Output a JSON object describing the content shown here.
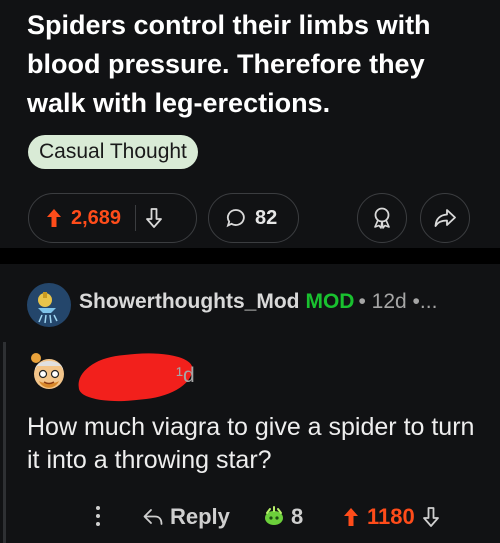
{
  "post": {
    "title": "Spiders control their limbs with blood pressure. Therefore they walk with leg-erections.",
    "flair": "Casual Thought",
    "upvotes": "2,689",
    "comments": "82"
  },
  "mod_comment": {
    "username": "Showerthoughts_Mod",
    "tag": "MOD",
    "meta": "• 12d •..."
  },
  "comment": {
    "time": "¹d",
    "body": "How much viagra to give a spider to turn it into a throwing star?",
    "reply_label": "Reply",
    "award_count": "8",
    "score": "1180"
  },
  "colors": {
    "upvote": "#ff4c1a",
    "flair_bg": "#d9ebd6",
    "mod_green": "#19c12f",
    "background": "#111214",
    "redaction": "#f2201c"
  },
  "icons": [
    "upvote-icon",
    "downvote-icon",
    "comment-bubble-icon",
    "award-icon",
    "share-icon",
    "more-icon",
    "reply-icon",
    "showerhead-avatar-icon"
  ]
}
